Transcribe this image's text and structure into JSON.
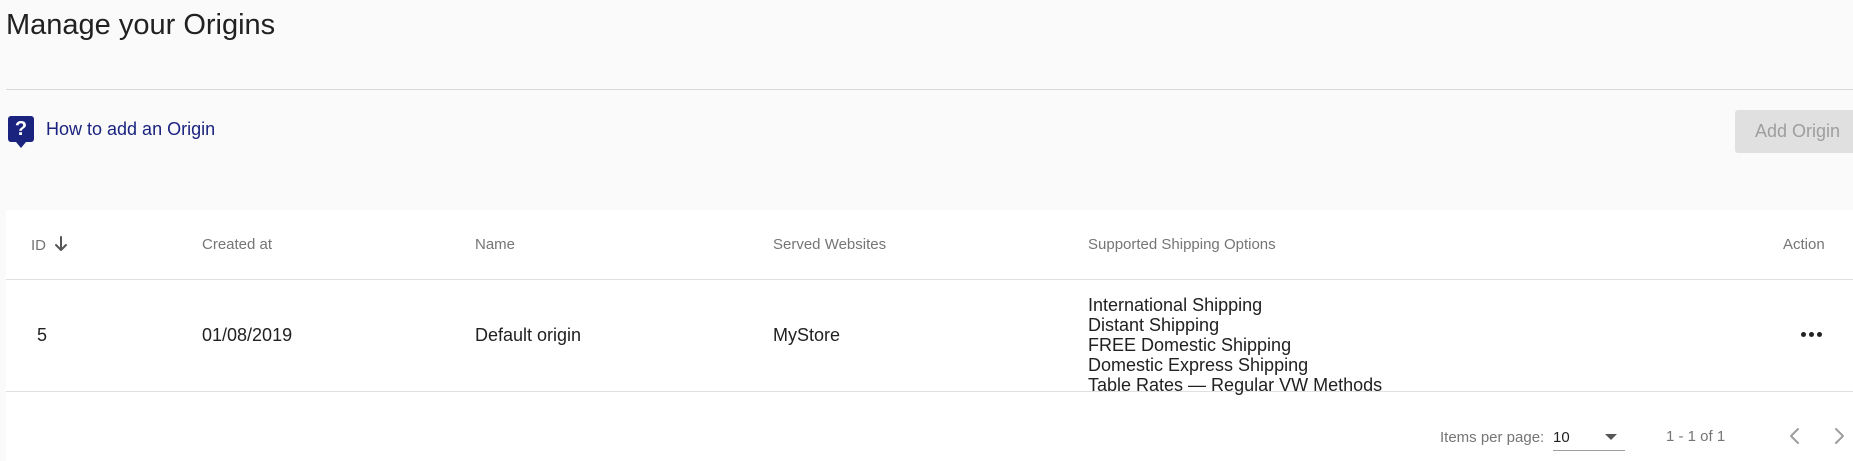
{
  "page": {
    "title": "Manage your Origins"
  },
  "help": {
    "icon_glyph": "?",
    "link_text": "How to add an Origin"
  },
  "toolbar": {
    "add_label": "Add Origin"
  },
  "table": {
    "headers": {
      "id": "ID",
      "created_at": "Created at",
      "name": "Name",
      "served_websites": "Served Websites",
      "shipping_options": "Supported Shipping Options",
      "action": "Action"
    },
    "rows": [
      {
        "id": "5",
        "created_at": "01/08/2019",
        "name": "Default origin",
        "served_websites": "MyStore",
        "shipping_options": [
          "International Shipping",
          "Distant Shipping",
          "FREE Domestic Shipping",
          "Domestic Express Shipping",
          "Table Rates — Regular VW Methods"
        ]
      }
    ]
  },
  "paginator": {
    "items_per_page_label": "Items per page:",
    "items_per_page_value": "10",
    "range_label": "1 - 1 of 1"
  },
  "colors": {
    "accent": "#1a237e",
    "disabled_bg": "#e0e0e0",
    "disabled_text": "#9e9e9e"
  }
}
